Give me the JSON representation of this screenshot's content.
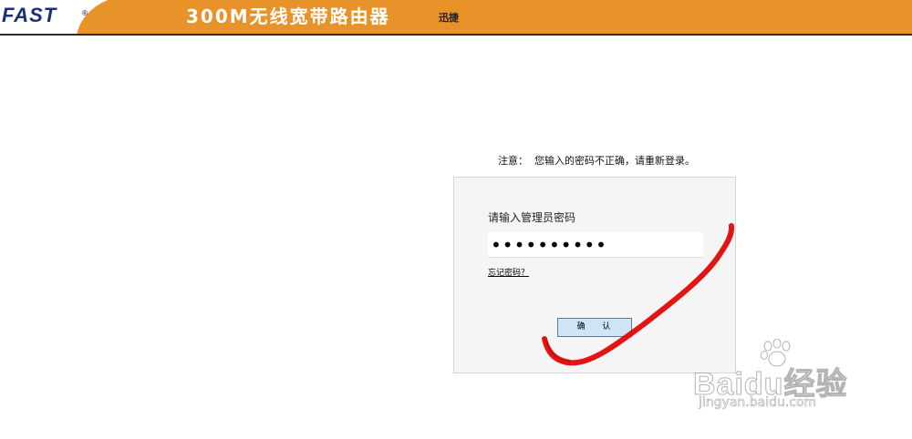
{
  "header": {
    "brand": "FAST",
    "brand_mark": "®",
    "product_title": "300M无线宽带路由器",
    "product_sub": "迅捷",
    "accent_color": "#e8932a"
  },
  "notice": {
    "text": "注意：  您输入的密码不正确，请重新登录。"
  },
  "login": {
    "label": "请输入管理员密码",
    "password_value": "••••••••••",
    "forgot_label": "忘记密码？",
    "confirm_label": "确 认"
  },
  "watermark": {
    "text": "Baidu经验",
    "url": "jingyan.baidu.com"
  },
  "annotation": {
    "color": "#e00000",
    "shape": "check-mark-stroke"
  }
}
